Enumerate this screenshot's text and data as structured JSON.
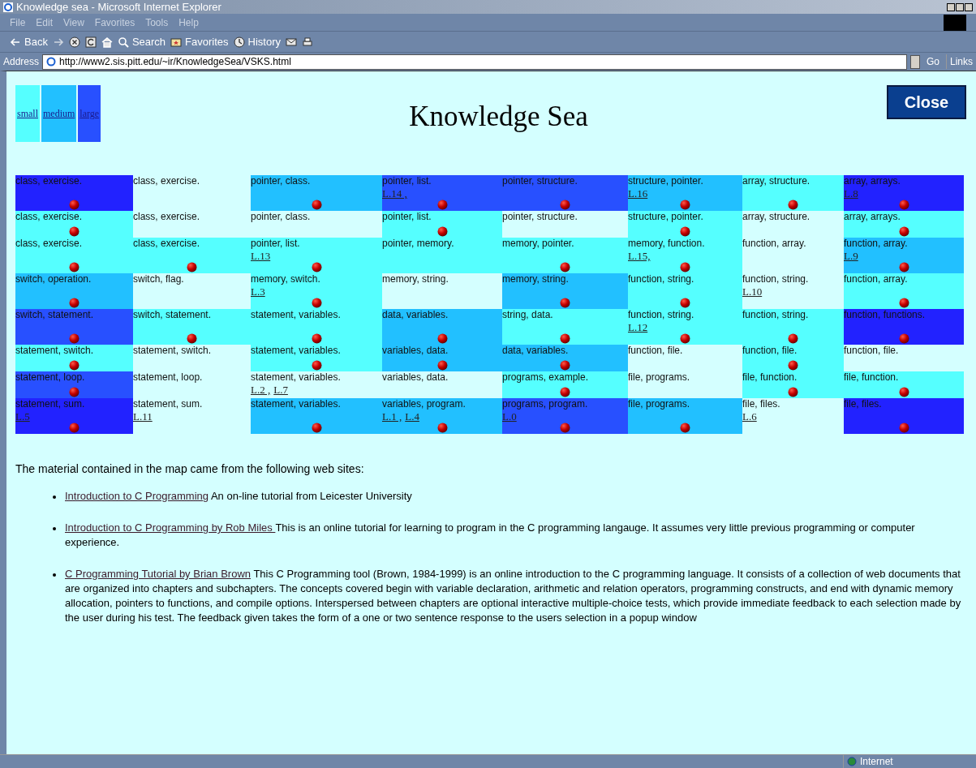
{
  "window": {
    "title": "Knowledge sea - Microsoft Internet Explorer"
  },
  "menu": [
    "File",
    "Edit",
    "View",
    "Favorites",
    "Tools",
    "Help"
  ],
  "toolbar": [
    {
      "kind": "back",
      "label": "Back"
    },
    {
      "kind": "forward"
    },
    {
      "kind": "stop"
    },
    {
      "kind": "refresh"
    },
    {
      "kind": "home"
    },
    {
      "kind": "search",
      "label": "Search"
    },
    {
      "kind": "favorites",
      "label": "Favorites"
    },
    {
      "kind": "history",
      "label": "History"
    },
    {
      "kind": "mail"
    },
    {
      "kind": "print"
    }
  ],
  "address": {
    "label": "Address",
    "value": "http://www2.sis.pitt.edu/~ir/KnowledgeSea/VSKS.html",
    "go": "Go",
    "links": "Links"
  },
  "sizes": [
    {
      "label": "small",
      "color": "#55ffff"
    },
    {
      "label": "medium",
      "color": "#22c0ff"
    },
    {
      "label": "large",
      "color": "#2850ff"
    }
  ],
  "heading": "Knowledge Sea",
  "close_button": "Close",
  "map": [
    [
      {
        "label": "class, exercise.",
        "color": "#2222ff",
        "dot": true
      },
      {
        "label": "class, exercise.",
        "color": "#d4ffff",
        "dot": false
      },
      {
        "label": "pointer, class.",
        "color": "#22c0ff",
        "dot": true
      },
      {
        "label": "pointer, list.",
        "color": "#2850ff",
        "links": [
          "L.14 ,"
        ],
        "dot": true
      },
      {
        "label": "pointer, structure.",
        "color": "#2850ff",
        "dot": true
      },
      {
        "label": "structure, pointer.",
        "color": "#22c0ff",
        "links": [
          "L.16"
        ],
        "dot": true
      },
      {
        "label": "array, structure.",
        "color": "#55ffff",
        "dot": true
      },
      {
        "label": "array, arrays.",
        "color": "#2222ff",
        "links": [
          "L.8"
        ],
        "dot": true
      }
    ],
    [
      {
        "label": "class, exercise.",
        "color": "#55ffff",
        "dot": true
      },
      {
        "label": "class, exercise.",
        "color": "#d4ffff",
        "dot": false
      },
      {
        "label": "pointer, class.",
        "color": "#d4ffff",
        "dot": false
      },
      {
        "label": "pointer, list.",
        "color": "#55ffff",
        "dot": true
      },
      {
        "label": "pointer, structure.",
        "color": "#d4ffff",
        "dot": false
      },
      {
        "label": "structure, pointer.",
        "color": "#55ffff",
        "dot": true
      },
      {
        "label": "array, structure.",
        "color": "#d4ffff",
        "dot": false
      },
      {
        "label": "array, arrays.",
        "color": "#55ffff",
        "dot": true
      }
    ],
    [
      {
        "label": "class, exercise.",
        "color": "#55ffff",
        "dot": true
      },
      {
        "label": "class, exercise.",
        "color": "#55ffff",
        "dot": true
      },
      {
        "label": "pointer, list.",
        "color": "#55ffff",
        "links": [
          "L.13"
        ],
        "dot": true
      },
      {
        "label": "pointer, memory.",
        "color": "#55ffff",
        "dot": false
      },
      {
        "label": "memory, pointer.",
        "color": "#55ffff",
        "dot": true
      },
      {
        "label": "memory, function.",
        "color": "#55ffff",
        "links": [
          "L.15,"
        ],
        "dot": true
      },
      {
        "label": "function, array.",
        "color": "#d4ffff",
        "dot": false
      },
      {
        "label": "function, array.",
        "color": "#22c0ff",
        "links": [
          "L.9"
        ],
        "dot": true
      }
    ],
    [
      {
        "label": "switch, operation.",
        "color": "#22c0ff",
        "dot": true
      },
      {
        "label": "switch, flag.",
        "color": "#d4ffff",
        "dot": false
      },
      {
        "label": "memory, switch.",
        "color": "#55ffff",
        "links": [
          "L.3"
        ],
        "dot": true
      },
      {
        "label": "memory, string.",
        "color": "#d4ffff",
        "dot": false
      },
      {
        "label": "memory, string.",
        "color": "#22c0ff",
        "dot": true
      },
      {
        "label": "function, string.",
        "color": "#55ffff",
        "dot": true
      },
      {
        "label": "function, string.",
        "color": "#d4ffff",
        "links": [
          "L.10"
        ],
        "dot": false
      },
      {
        "label": "function, array.",
        "color": "#55ffff",
        "dot": true
      }
    ],
    [
      {
        "label": "switch, statement.",
        "color": "#2850ff",
        "dot": true
      },
      {
        "label": "switch, statement.",
        "color": "#55ffff",
        "dot": true
      },
      {
        "label": "statement, variables.",
        "color": "#55ffff",
        "dot": true
      },
      {
        "label": "data, variables.",
        "color": "#22c0ff",
        "dot": true
      },
      {
        "label": "string, data.",
        "color": "#55ffff",
        "dot": true
      },
      {
        "label": "function, string.",
        "color": "#55ffff",
        "links": [
          "L.12"
        ],
        "dot": true
      },
      {
        "label": "function, string.",
        "color": "#55ffff",
        "dot": true
      },
      {
        "label": "function, functions.",
        "color": "#2222ff",
        "dot": true
      }
    ],
    [
      {
        "label": "statement, switch.",
        "color": "#55ffff",
        "dot": true
      },
      {
        "label": "statement, switch.",
        "color": "#d4ffff",
        "dot": false
      },
      {
        "label": "statement, variables.",
        "color": "#55ffff",
        "dot": true
      },
      {
        "label": "variables, data.",
        "color": "#22c0ff",
        "dot": true
      },
      {
        "label": "data, variables.",
        "color": "#22c0ff",
        "dot": true
      },
      {
        "label": "function, file.",
        "color": "#d4ffff",
        "dot": false
      },
      {
        "label": "function, file.",
        "color": "#55ffff",
        "dot": true
      },
      {
        "label": "function, file.",
        "color": "#d4ffff",
        "dot": false
      }
    ],
    [
      {
        "label": "statement, loop.",
        "color": "#2850ff",
        "dot": true
      },
      {
        "label": "statement, loop.",
        "color": "#d4ffff",
        "dot": false
      },
      {
        "label": "statement, variables.",
        "color": "#d4ffff",
        "links": [
          "L.2 ,",
          "L.7"
        ],
        "dot": false
      },
      {
        "label": "variables, data.",
        "color": "#d4ffff",
        "dot": false
      },
      {
        "label": "programs, example.",
        "color": "#55ffff",
        "dot": true
      },
      {
        "label": "file, programs.",
        "color": "#d4ffff",
        "dot": false
      },
      {
        "label": "file, function.",
        "color": "#55ffff",
        "dot": true
      },
      {
        "label": "file, function.",
        "color": "#55ffff",
        "dot": true
      }
    ],
    [
      {
        "label": "statement, sum.",
        "color": "#2222ff",
        "links": [
          "L.5"
        ],
        "dot": true
      },
      {
        "label": "statement, sum.",
        "color": "#d4ffff",
        "links": [
          "L.11"
        ],
        "dot": false
      },
      {
        "label": "statement, variables.",
        "color": "#22c0ff",
        "dot": true
      },
      {
        "label": "variables, program.",
        "color": "#22c0ff",
        "links": [
          "L.1 ,",
          "L.4"
        ],
        "dot": true
      },
      {
        "label": "programs, program.",
        "color": "#2850ff",
        "links": [
          "L.0"
        ],
        "dot": true
      },
      {
        "label": "file, programs.",
        "color": "#22c0ff",
        "dot": true
      },
      {
        "label": "file, files.",
        "color": "#d4ffff",
        "links": [
          "L.6"
        ],
        "dot": false
      },
      {
        "label": "file, files.",
        "color": "#2222ff",
        "dot": true
      }
    ]
  ],
  "sources_intro": "The material contained in the map came from the following web sites:",
  "sources": [
    {
      "link": "Introduction to C Programming",
      "text": "An on-line tutorial from Leicester University"
    },
    {
      "link": "Introduction to C Programming by Rob Miles ",
      "text": "This is an online tutorial for learning to program in the C programming langauge. It assumes very little previous programming or computer experience."
    },
    {
      "link": "C Programming Tutorial by Brian Brown",
      "text": "This C Programming tool (Brown, 1984-1999) is an online introduction to the C programming language. It consists of a collection of web documents that are organized into chapters and subchapters. The concepts covered begin with variable declaration, arithmetic and relation operators, programming constructs, and end with dynamic memory allocation, pointers to functions, and compile options. Interspersed between chapters are optional interactive multiple-choice tests, which provide immediate feedback to each selection made by the user during his test. The feedback given takes the form of a one or two sentence response to the users selection in a popup window"
    }
  ],
  "status_bar": {
    "zone": "Internet"
  }
}
